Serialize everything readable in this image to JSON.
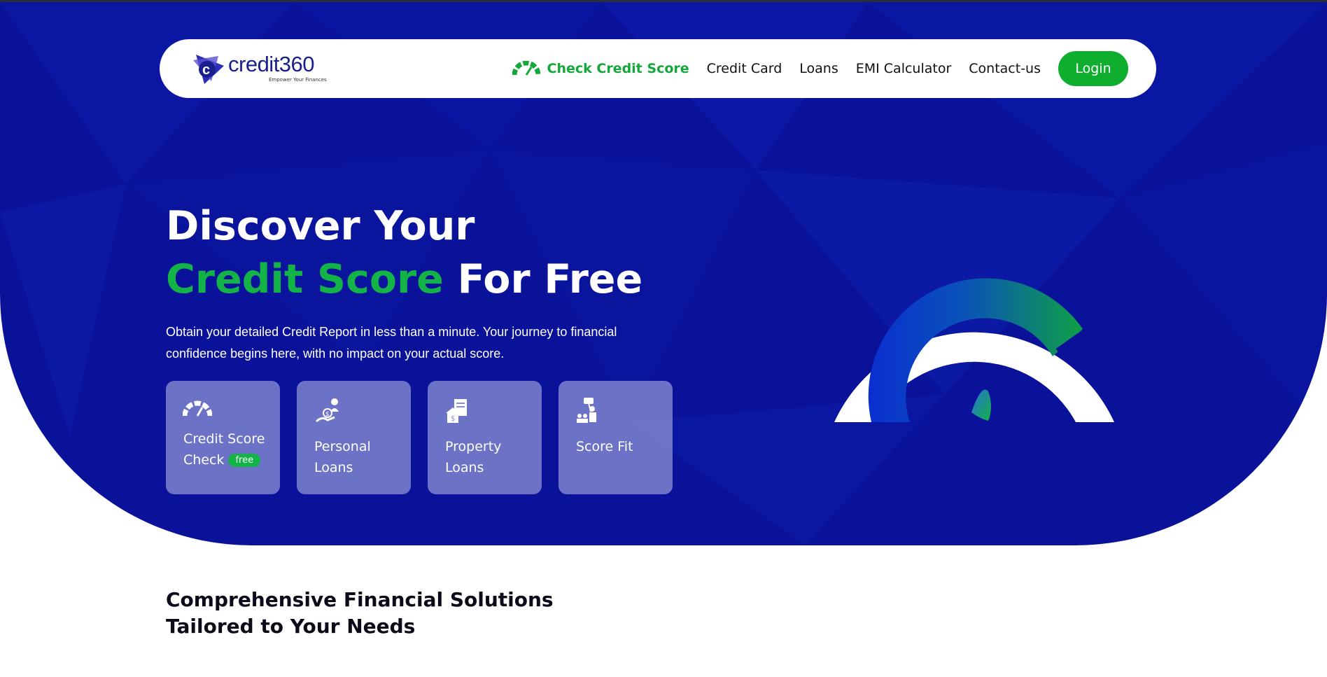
{
  "nav": {
    "brand": "credit360",
    "tagline": "Empower Your Finances",
    "cta_label": "Check Credit Score",
    "links": [
      "Credit Card",
      "Loans",
      "EMI Calculator",
      "Contact-us"
    ],
    "login_label": "Login"
  },
  "hero": {
    "headline_line1": "Discover Your",
    "headline_highlight": "Credit Score",
    "headline_rest": " For Free",
    "description": "Obtain your detailed Credit Report in less than a minute. Your journey to financial confidence begins here, with no impact on your actual score.",
    "cards": [
      {
        "line1": "Credit Score",
        "line2": "Check",
        "badge": "free",
        "icon": "speedometer-icon"
      },
      {
        "line1": "Personal",
        "line2": "Loans",
        "icon": "money-hand-icon"
      },
      {
        "line1": "Property",
        "line2": "Loans",
        "icon": "house-document-icon"
      },
      {
        "line1": "Score Fit",
        "line2": "",
        "icon": "people-presentation-icon"
      }
    ]
  },
  "section": {
    "title_line1": "Comprehensive Financial Solutions",
    "title_line2": "Tailored to Your Needs"
  },
  "colors": {
    "hero_bg": "#0a129a",
    "accent_green": "#13b347",
    "button_green": "#0fae2f",
    "card_bg": "rgba(170,175,225,0.62)"
  }
}
